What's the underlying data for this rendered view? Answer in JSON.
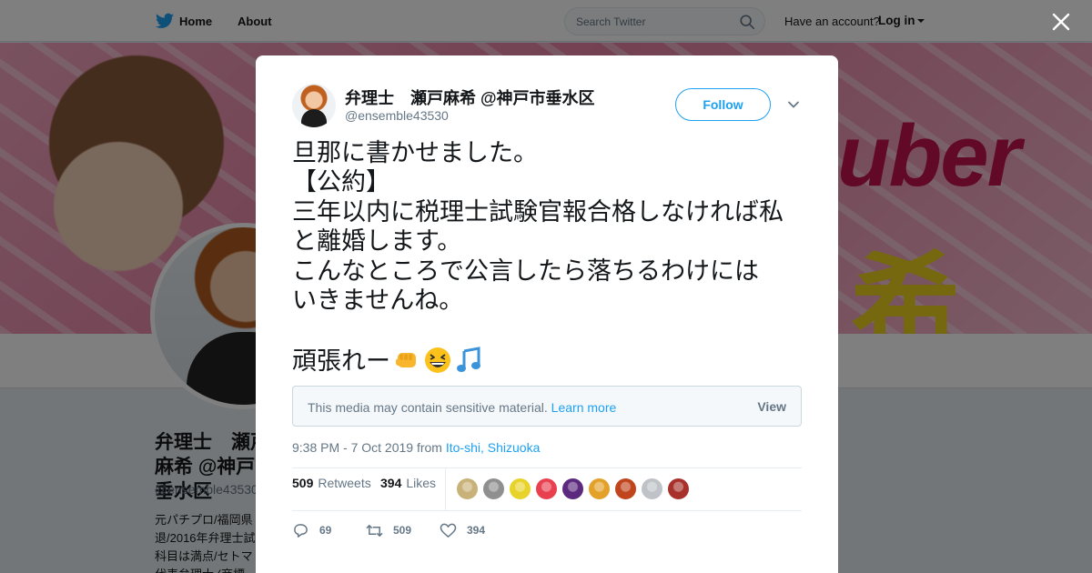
{
  "nav": {
    "home_label": "Home",
    "about_label": "About",
    "search_placeholder": "Search Twitter",
    "account_prompt": "Have an account?",
    "login_label": "Log in"
  },
  "profile": {
    "name": "弁理士　瀬戸麻希 @神戸市垂水区",
    "handle": "@ensemble43530",
    "bio": "元パチプロ/福岡県\n退/2016年弁理士試\n科目は満点/セトマ\n代表弁理士 (商標…"
  },
  "tweet": {
    "author_name": "弁理士　瀬戸麻希 @神戸市垂水区",
    "author_handle": "@ensemble43530",
    "follow_label": "Follow",
    "text_lines": [
      "旦那に書かせました。",
      "【公約】",
      "三年以内に税理士試験官報合格しなければ私",
      "と離婚します。",
      "こんなところで公言したら落ちるわけには",
      "いきませんね。",
      "",
      "頑張れー"
    ],
    "trailing_emojis": [
      "oncoming-fist-emoji",
      "grinning-squinting-face-emoji",
      "musical-notes-emoji"
    ],
    "sensitive_notice": "This media may contain sensitive material.",
    "learn_more_label": "Learn more",
    "view_label": "View",
    "timestamp": "9:38 PM - 7 Oct 2019 from",
    "location": "Ito-shi, Shizuoka",
    "retweets_count": "509",
    "retweets_label": "Retweets",
    "likes_count": "394",
    "likes_label": "Likes",
    "reply_count": "69",
    "retweet_action_count": "509",
    "like_action_count": "394"
  },
  "likers": [
    {
      "name": "liker-avatar-1",
      "color": "#c9b27a"
    },
    {
      "name": "liker-avatar-2",
      "color": "#8f8f8f"
    },
    {
      "name": "liker-avatar-3",
      "color": "#e8d32a"
    },
    {
      "name": "liker-avatar-4",
      "color": "#e8404f"
    },
    {
      "name": "liker-avatar-5",
      "color": "#5b2a7e"
    },
    {
      "name": "liker-avatar-6",
      "color": "#e3a12a"
    },
    {
      "name": "liker-avatar-7",
      "color": "#c0441c"
    },
    {
      "name": "liker-avatar-8",
      "color": "#bfc3c7"
    },
    {
      "name": "liker-avatar-9",
      "color": "#a8322b"
    }
  ],
  "colors": {
    "accent": "#1da1f2",
    "text_secondary": "#657786"
  }
}
